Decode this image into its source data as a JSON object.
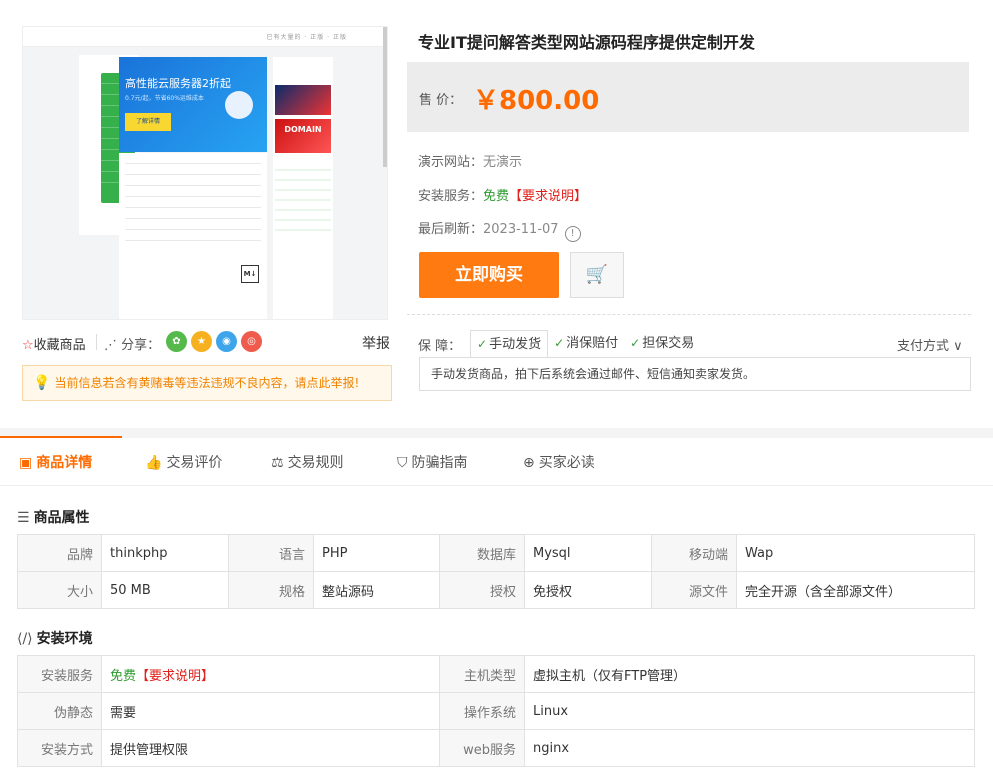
{
  "product": {
    "title": "专业IT提问解答类型网站源码程序提供定制开发",
    "image": {
      "top_text": "已有大量的 · 正版 · 正版",
      "banner_title": "高性能云服务器2折起",
      "banner_sub": "0.7元/起，节省60%运维成本",
      "banner_btn": "了解详情",
      "ad_text": "DOMAIN",
      "markdown_tag": "M↓"
    },
    "price_label": "售  价：",
    "price": "￥800.00",
    "demo_label": "演示网站：",
    "demo_value": "无演示",
    "install_label": "安装服务：",
    "install_free": "免费",
    "install_req": "【要求说明】",
    "refresh_label": "最后刷新：",
    "refresh_date": "2023-11-07",
    "buy_button": "立即购买",
    "cart_icon": "cart-icon"
  },
  "left_actions": {
    "favorite": "收藏商品",
    "share_label": "分享：",
    "share_icons": [
      "wechat-icon",
      "qzone-icon",
      "qq-icon",
      "weibo-icon"
    ],
    "report": "举报",
    "notice": "当前信息若含有黄赌毒等违法违规不良内容，请点此举报!"
  },
  "guarantee": {
    "label": "保  障：",
    "tabs": [
      "手动发货",
      "消保赔付",
      "担保交易"
    ],
    "payment": "支付方式",
    "desc": "手动发货商品，拍下后系统会通过邮件、短信通知卖家发货。"
  },
  "tabs": [
    "商品详情",
    "交易评价",
    "交易规则",
    "防骗指南",
    "买家必读"
  ],
  "attributes": {
    "title": "商品属性",
    "rows": [
      [
        [
          "品牌",
          "thinkphp"
        ],
        [
          "语言",
          "PHP"
        ],
        [
          "数据库",
          "Mysql"
        ],
        [
          "移动端",
          "Wap"
        ]
      ],
      [
        [
          "大小",
          "50 MB"
        ],
        [
          "规格",
          "整站源码"
        ],
        [
          "授权",
          "免授权"
        ],
        [
          "源文件",
          "完全开源（含全部源文件）"
        ]
      ]
    ]
  },
  "environment": {
    "title": "安装环境",
    "service_label": "安装服务",
    "service_free": "免费",
    "service_req": "【要求说明】",
    "host_label": "主机类型",
    "host_value": "虚拟主机（仅有FTP管理）",
    "rewrite_label": "伪静态",
    "rewrite_value": "需要",
    "os_label": "操作系统",
    "os_value": "Linux",
    "method_label": "安装方式",
    "method_value": "提供管理权限",
    "web_label": "web服务",
    "web_value": "nginx"
  }
}
